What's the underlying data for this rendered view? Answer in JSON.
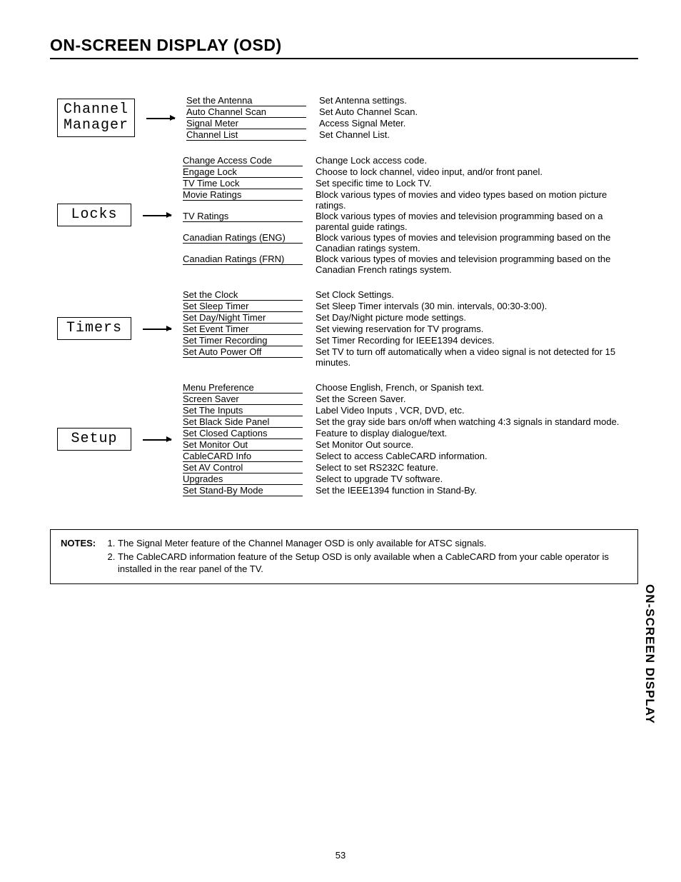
{
  "pageTitle": "ON-SCREEN DISPLAY (OSD)",
  "sideTab": "ON-SCREEN DISPLAY",
  "pageNumber": "53",
  "sections": [
    {
      "name": "Channel\nManager",
      "items": [
        {
          "label": "Set the Antenna",
          "desc": "Set Antenna settings."
        },
        {
          "label": "Auto Channel Scan",
          "desc": "Set Auto Channel Scan."
        },
        {
          "label": "Signal Meter",
          "desc": "Access Signal Meter."
        },
        {
          "label": "Channel List",
          "desc": "Set Channel List."
        }
      ]
    },
    {
      "name": "Locks",
      "items": [
        {
          "label": "Change Access Code",
          "desc": "Change Lock access code."
        },
        {
          "label": "Engage Lock",
          "desc": "Choose to lock channel, video input, and/or front panel."
        },
        {
          "label": "TV Time Lock",
          "desc": "Set specific time to Lock TV."
        },
        {
          "label": "Movie Ratings",
          "desc": "Block various types of movies and video types based on motion picture ratings."
        },
        {
          "label": "TV Ratings",
          "desc": "Block various types of movies and television programming based on a parental guide ratings."
        },
        {
          "label": "Canadian Ratings (ENG)",
          "desc": "Block various types of movies and television programming based on the Canadian ratings system."
        },
        {
          "label": "Canadian Ratings (FRN)",
          "desc": "Block various types of movies and television programming based on the Canadian French ratings system."
        }
      ]
    },
    {
      "name": "Timers",
      "items": [
        {
          "label": "Set the Clock",
          "desc": "Set Clock Settings."
        },
        {
          "label": "Set Sleep Timer",
          "desc": "Set Sleep Timer intervals (30 min. intervals, 00:30-3:00)."
        },
        {
          "label": "Set Day/Night Timer",
          "desc": "Set Day/Night picture mode settings."
        },
        {
          "label": "Set Event Timer",
          "desc": "Set viewing reservation for TV programs."
        },
        {
          "label": "Set Timer Recording",
          "desc": "Set Timer Recording for IEEE1394 devices."
        },
        {
          "label": "Set Auto Power Off",
          "desc": "Set TV to turn off automatically when a video signal is not detected for 15 minutes."
        }
      ]
    },
    {
      "name": "Setup",
      "items": [
        {
          "label": "Menu Preference",
          "desc": "Choose English, French, or Spanish text."
        },
        {
          "label": "Screen Saver",
          "desc": "Set the Screen Saver."
        },
        {
          "label": "Set The Inputs",
          "desc": "Label Video Inputs , VCR, DVD, etc."
        },
        {
          "label": "Set Black Side Panel",
          "desc": "Set the gray side bars on/off when watching 4:3 signals in standard mode."
        },
        {
          "label": "Set Closed Captions",
          "desc": "Feature to display dialogue/text."
        },
        {
          "label": "Set Monitor Out",
          "desc": "Set Monitor Out source."
        },
        {
          "label": "CableCARD Info",
          "desc": "Select to access CableCARD information."
        },
        {
          "label": "Set AV Control",
          "desc": "Select to set RS232C feature."
        },
        {
          "label": "Upgrades",
          "desc": "Select to upgrade TV software."
        },
        {
          "label": "Set Stand-By Mode",
          "desc": "Set the IEEE1394 function in Stand-By."
        }
      ]
    }
  ],
  "notes": {
    "label": "NOTES:",
    "items": [
      "The Signal Meter feature of the Channel Manager OSD is only available for ATSC signals.",
      "The CableCARD information feature of the Setup OSD is only available when a CableCARD from your cable operator is installed in the rear panel of the TV."
    ]
  }
}
